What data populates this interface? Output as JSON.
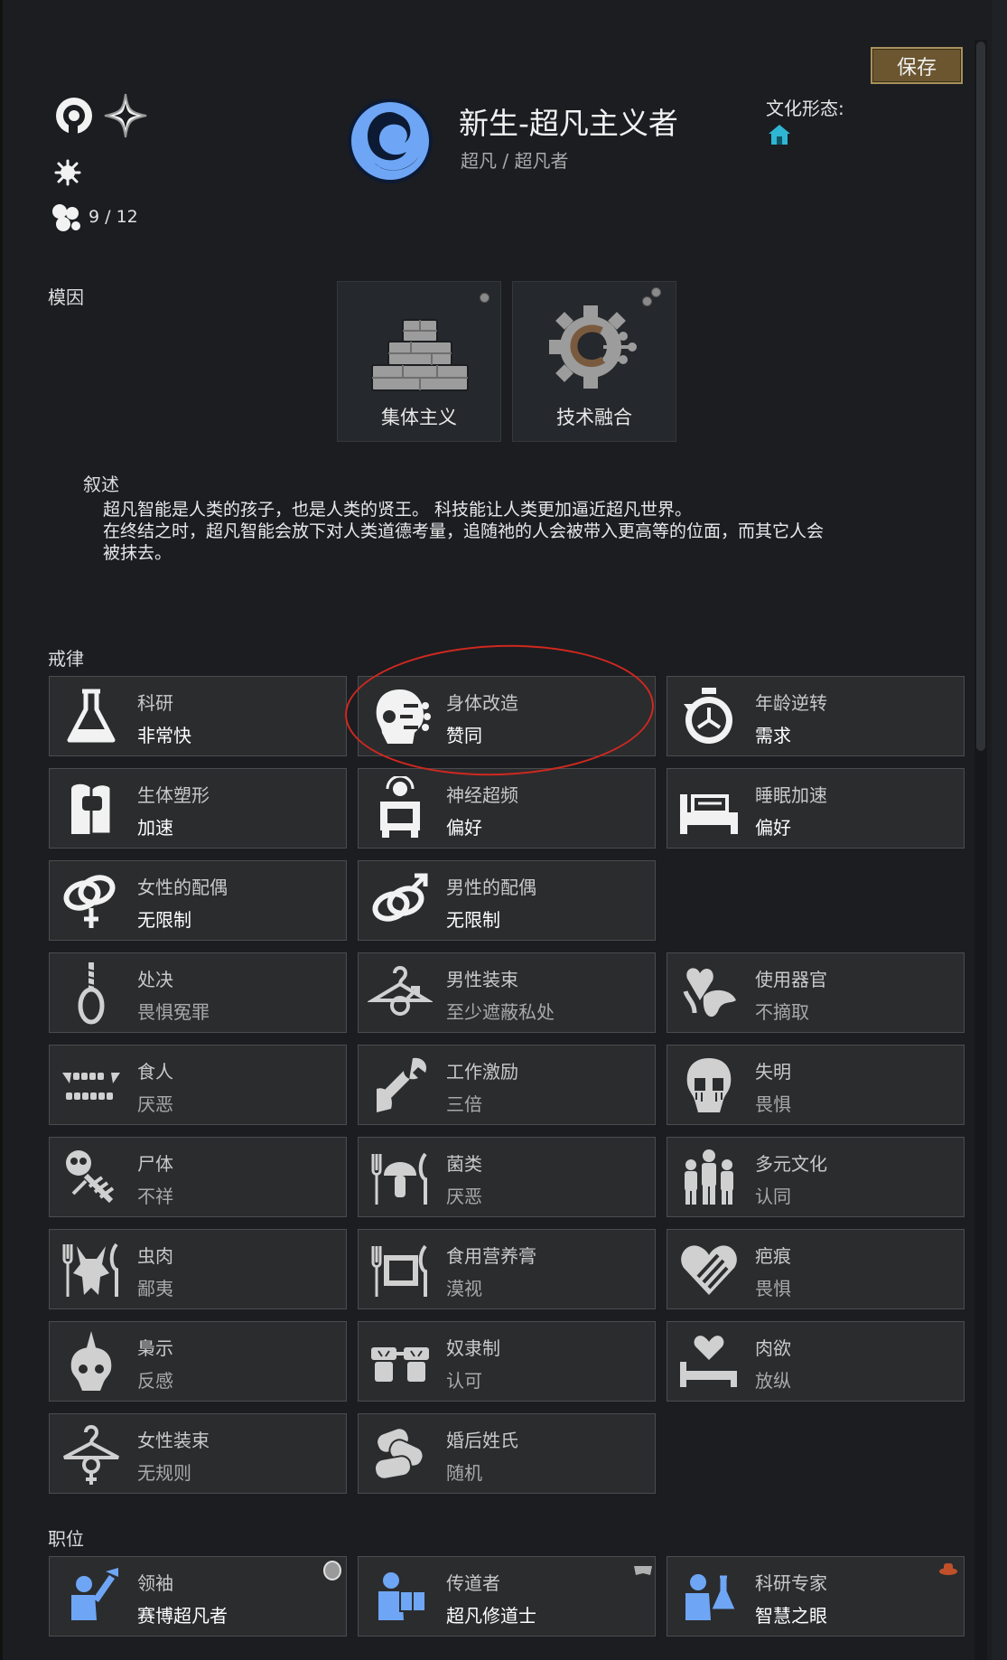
{
  "header": {
    "save_label": "保存",
    "title": "新生-超凡主义者",
    "subtitle": "超凡 / 超凡者",
    "culture_label": "文化形态:",
    "culture_icon": "house-icon",
    "count": "9 / 12"
  },
  "memes": {
    "label": "模因",
    "items": [
      {
        "label": "集体主义",
        "icon": "brick-pyramid-icon"
      },
      {
        "label": "技术融合",
        "icon": "gear-circuit-icon"
      }
    ]
  },
  "narrative": {
    "label": "叙述",
    "lines": [
      "超凡智能是人类的孩子，也是人类的贤王。 科技能让人类更加逼近超凡世界。",
      "在终结之时，超凡智能会放下对人类道德考量，追随祂的人会被带入更高等的位面，而其它人会",
      "被抹去。"
    ]
  },
  "precepts": {
    "label": "戒律",
    "items": [
      {
        "name": "科研",
        "value": "非常快",
        "icon": "flask-icon"
      },
      {
        "name": "身体改造",
        "value": "赞同",
        "icon": "cyber-skull-icon"
      },
      {
        "name": "年龄逆转",
        "value": "需求",
        "icon": "stopwatch-icon"
      },
      {
        "name": "生体塑形",
        "value": "加速",
        "icon": "bed-pod-icon"
      },
      {
        "name": "神经超频",
        "value": "偏好",
        "icon": "neural-machine-icon"
      },
      {
        "name": "睡眠加速",
        "value": "偏好",
        "icon": "bed-icon"
      },
      {
        "name": "女性的配偶",
        "value": "无限制",
        "icon": "female-rings-icon"
      },
      {
        "name": "男性的配偶",
        "value": "无限制",
        "icon": "male-rings-icon"
      },
      {
        "name": "处决",
        "value": "畏惧冤罪",
        "icon": "noose-icon"
      },
      {
        "name": "男性装束",
        "value": "至少遮蔽私处",
        "icon": "hanger-male-icon"
      },
      {
        "name": "使用器官",
        "value": "不摘取",
        "icon": "organs-icon"
      },
      {
        "name": "食人",
        "value": "厌恶",
        "icon": "teeth-icon"
      },
      {
        "name": "工作激励",
        "value": "三倍",
        "icon": "wrench-hand-icon"
      },
      {
        "name": "失明",
        "value": "畏惧",
        "icon": "blind-skull-icon"
      },
      {
        "name": "尸体",
        "value": "不祥",
        "icon": "skeleton-icon"
      },
      {
        "name": "菌类",
        "value": "厌恶",
        "icon": "mushroom-cutlery-icon"
      },
      {
        "name": "多元文化",
        "value": "认同",
        "icon": "people-group-icon"
      },
      {
        "name": "虫肉",
        "value": "鄙夷",
        "icon": "insect-cutlery-icon"
      },
      {
        "name": "食用营养膏",
        "value": "漠视",
        "icon": "nutrient-paste-icon"
      },
      {
        "name": "疤痕",
        "value": "畏惧",
        "icon": "scarred-heart-icon"
      },
      {
        "name": "梟示",
        "value": "反感",
        "icon": "spiked-skull-icon"
      },
      {
        "name": "奴隶制",
        "value": "认可",
        "icon": "shackles-icon"
      },
      {
        "name": "肉欲",
        "value": "放纵",
        "icon": "heart-bed-icon"
      },
      {
        "name": "女性装束",
        "value": "无规则",
        "icon": "hanger-female-icon"
      },
      {
        "name": "婚后姓氏",
        "value": "随机",
        "icon": "scrolls-icon"
      }
    ]
  },
  "roles": {
    "label": "职位",
    "items": [
      {
        "name": "领袖",
        "value": "赛博超凡者",
        "icon": "leader-icon",
        "badge": "shield-badge-icon"
      },
      {
        "name": "传道者",
        "value": "超凡修道士",
        "icon": "preacher-icon",
        "badge": "book-badge-icon"
      },
      {
        "name": "科研专家",
        "value": "智慧之眼",
        "icon": "researcher-icon",
        "badge": "hat-badge-icon"
      }
    ]
  },
  "colors": {
    "accent": "#6ea6f5",
    "save": "#6b5630",
    "highlight": "#d0281f",
    "culture": "#2fb6d4"
  }
}
